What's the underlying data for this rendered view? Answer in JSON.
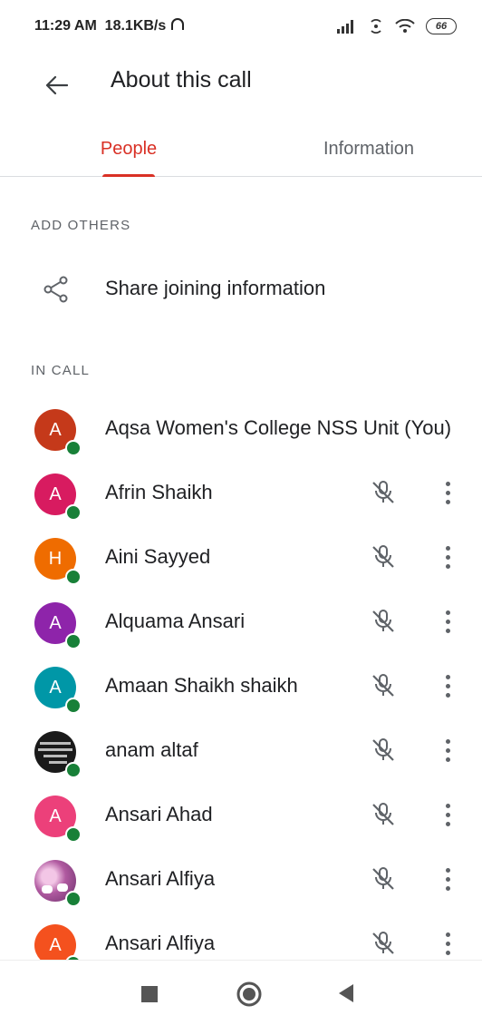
{
  "status_bar": {
    "time": "11:29 AM",
    "speed": "18.1KB/s",
    "battery": "66"
  },
  "app_bar": {
    "title": "About this call"
  },
  "tabs": [
    {
      "label": "People",
      "active": true
    },
    {
      "label": "Information",
      "active": false
    }
  ],
  "add_others": {
    "header": "ADD OTHERS",
    "share_label": "Share joining information"
  },
  "in_call": {
    "header": "IN CALL",
    "participants": [
      {
        "initial": "A",
        "name": "Aqsa Women's College NSS Unit (You)",
        "color": "#c5391a"
      },
      {
        "initial": "A",
        "name": "Afrin Shaikh",
        "color": "#d81b60"
      },
      {
        "initial": "H",
        "name": "Aini Sayyed",
        "color": "#ef6c00"
      },
      {
        "initial": "A",
        "name": "Alquama Ansari",
        "color": "#8e24aa"
      },
      {
        "initial": "A",
        "name": "Amaan Shaikh shaikh",
        "color": "#0097a7"
      },
      {
        "initial": "",
        "name": "anam altaf",
        "color": "#1a1a1a"
      },
      {
        "initial": "A",
        "name": "Ansari Ahad",
        "color": "#ec407a"
      },
      {
        "initial": "",
        "name": "Ansari Alfiya",
        "color": "#b05aa0"
      },
      {
        "initial": "A",
        "name": "Ansari Alfiya",
        "color": "#f4511e"
      }
    ]
  },
  "colors": {
    "accent": "#d93025",
    "online": "#188038",
    "muted_icon": "#5f6368"
  }
}
